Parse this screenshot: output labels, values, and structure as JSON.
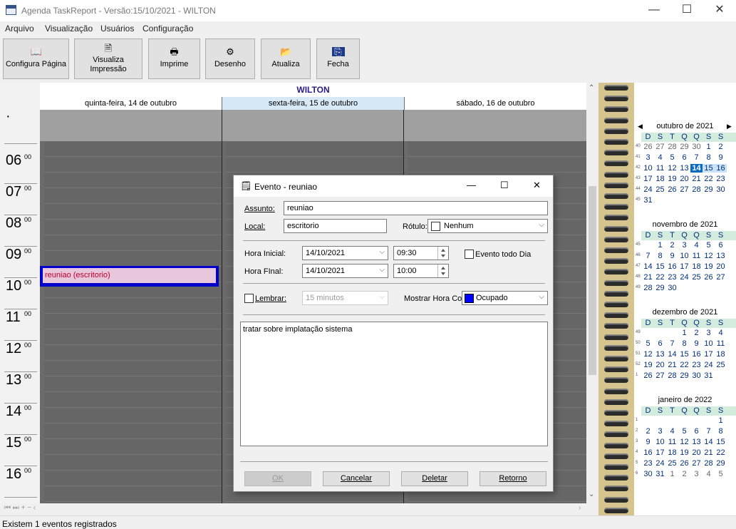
{
  "window": {
    "title": "Agenda TaskReport - Versão:15/10/2021 - WILTON",
    "min": "—",
    "max": "☐",
    "close": "✕"
  },
  "menu": [
    "Arquivo",
    "Visualização",
    "Usuários",
    "Configuração"
  ],
  "toolbar": [
    {
      "label": "Configura Página",
      "icon": "book-icon",
      "glyph": "📖"
    },
    {
      "label": "Visualiza Impressão",
      "icon": "preview-icon",
      "glyph": "🗎"
    },
    {
      "label": "Imprime",
      "icon": "printer-icon",
      "glyph": "🖶"
    },
    {
      "label": "Desenho",
      "icon": "gear-icon",
      "glyph": "⚙"
    },
    {
      "label": "Atualiza",
      "icon": "folder-icon",
      "glyph": "📂"
    },
    {
      "label": "Fecha",
      "icon": "exit-icon",
      "glyph": "⎘"
    }
  ],
  "calendar": {
    "owner": "WILTON",
    "days": [
      "quinta-feira, 14 de outubro",
      "sexta-feira, 15 de outubro",
      "sábado, 16 de outubro"
    ],
    "hours": [
      "06",
      "07",
      "08",
      "09",
      "10",
      "11",
      "12",
      "13",
      "14",
      "15",
      "16"
    ],
    "minutes": "00",
    "event": {
      "text": "reuniao (escritorio)"
    },
    "colors": {
      "today_header": "#d7e9f7",
      "event_bg": "#e8c6dc",
      "event_border": "#0000cc"
    }
  },
  "status": "Existem 1 eventos registrados",
  "dialog": {
    "title": "Evento - reuniao",
    "assunto_label": "Assunto:",
    "assunto": "reuniao",
    "local_label": "Local:",
    "local": "escritorio",
    "rotulo_label": "Rótulo:",
    "rotulo": "Nenhum",
    "hora_inicial_label": "Hora Inicial:",
    "data_inicial": "14/10/2021",
    "hora_inicial": "09:30",
    "hora_final_label": "Hora FInal:",
    "data_final": "14/10/2021",
    "hora_final": "10:00",
    "todo_dia_label": "Evento todo Dia",
    "lembrar_label": "Lembrar:",
    "lembrar": "15 minutos",
    "mostrar_label": "Mostrar Hora Co",
    "mostrar": "Ocupado",
    "mostrar_color": "#0000ff",
    "notes": "tratar sobre implatação sistema",
    "buttons": {
      "ok": "OK",
      "cancelar": "Cancelar",
      "deletar": "Deletar",
      "retorno": "Retorno"
    }
  },
  "mini_calendar": {
    "weekday_headers": [
      "D",
      "S",
      "T",
      "Q",
      "Q",
      "S",
      "S"
    ],
    "months": [
      {
        "title": "outubro de 2021",
        "prev": "◀",
        "next": "▶",
        "weeks": [
          {
            "n": "40",
            "days": [
              "26",
              "27",
              "28",
              "29",
              "30",
              "1",
              "2"
            ],
            "other": [
              0,
              1,
              2,
              3,
              4
            ]
          },
          {
            "n": "41",
            "days": [
              "3",
              "4",
              "5",
              "6",
              "7",
              "8",
              "9"
            ]
          },
          {
            "n": "42",
            "days": [
              "10",
              "11",
              "12",
              "13",
              "14",
              "15",
              "16"
            ],
            "sel": 4,
            "sel2": [
              5,
              6
            ]
          },
          {
            "n": "43",
            "days": [
              "17",
              "18",
              "19",
              "20",
              "21",
              "22",
              "23"
            ]
          },
          {
            "n": "44",
            "days": [
              "24",
              "25",
              "26",
              "27",
              "28",
              "29",
              "30"
            ]
          },
          {
            "n": "45",
            "days": [
              "31",
              "",
              "",
              "",
              "",
              "",
              ""
            ]
          }
        ]
      },
      {
        "title": "novembro de 2021",
        "weeks": [
          {
            "n": "45",
            "days": [
              "",
              "1",
              "2",
              "3",
              "4",
              "5",
              "6"
            ]
          },
          {
            "n": "46",
            "days": [
              "7",
              "8",
              "9",
              "10",
              "11",
              "12",
              "13"
            ]
          },
          {
            "n": "47",
            "days": [
              "14",
              "15",
              "16",
              "17",
              "18",
              "19",
              "20"
            ]
          },
          {
            "n": "48",
            "days": [
              "21",
              "22",
              "23",
              "24",
              "25",
              "26",
              "27"
            ]
          },
          {
            "n": "49",
            "days": [
              "28",
              "29",
              "30",
              "",
              "",
              "",
              ""
            ]
          }
        ]
      },
      {
        "title": "dezembro de 2021",
        "weeks": [
          {
            "n": "49",
            "days": [
              "",
              "",
              "",
              "1",
              "2",
              "3",
              "4"
            ]
          },
          {
            "n": "50",
            "days": [
              "5",
              "6",
              "7",
              "8",
              "9",
              "10",
              "11"
            ]
          },
          {
            "n": "51",
            "days": [
              "12",
              "13",
              "14",
              "15",
              "16",
              "17",
              "18"
            ]
          },
          {
            "n": "52",
            "days": [
              "19",
              "20",
              "21",
              "22",
              "23",
              "24",
              "25"
            ]
          },
          {
            "n": "1",
            "days": [
              "26",
              "27",
              "28",
              "29",
              "30",
              "31",
              ""
            ]
          }
        ]
      },
      {
        "title": "janeiro de 2022",
        "weeks": [
          {
            "n": "1",
            "days": [
              "",
              "",
              "",
              "",
              "",
              "",
              "1"
            ]
          },
          {
            "n": "2",
            "days": [
              "2",
              "3",
              "4",
              "5",
              "6",
              "7",
              "8"
            ]
          },
          {
            "n": "3",
            "days": [
              "9",
              "10",
              "11",
              "12",
              "13",
              "14",
              "15"
            ]
          },
          {
            "n": "4",
            "days": [
              "16",
              "17",
              "18",
              "19",
              "20",
              "21",
              "22"
            ]
          },
          {
            "n": "5",
            "days": [
              "23",
              "24",
              "25",
              "26",
              "27",
              "28",
              "29"
            ]
          },
          {
            "n": "6",
            "days": [
              "30",
              "31",
              "1",
              "2",
              "3",
              "4",
              "5"
            ],
            "other": [
              2,
              3,
              4,
              5,
              6
            ]
          }
        ]
      }
    ]
  }
}
